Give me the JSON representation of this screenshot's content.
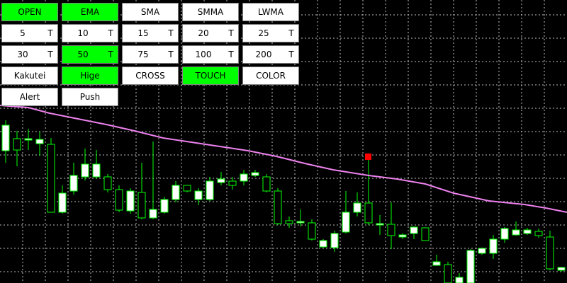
{
  "panel": {
    "row1": [
      {
        "label": "OPEN",
        "active": true
      },
      {
        "label": "EMA",
        "active": true
      },
      {
        "label": "SMA",
        "active": false
      },
      {
        "label": "SMMA",
        "active": false
      },
      {
        "label": "LWMA",
        "active": false
      }
    ],
    "periods": [
      {
        "value": "5",
        "t": "T",
        "active": false
      },
      {
        "value": "10",
        "t": "T",
        "active": false
      },
      {
        "value": "15",
        "t": "T",
        "active": false
      },
      {
        "value": "20",
        "t": "T",
        "active": false
      },
      {
        "value": "25",
        "t": "T",
        "active": false
      },
      {
        "value": "30",
        "t": "T",
        "active": false
      },
      {
        "value": "50",
        "t": "T",
        "active": true
      },
      {
        "value": "75",
        "t": "T",
        "active": false
      },
      {
        "value": "100",
        "t": "T",
        "active": false
      },
      {
        "value": "200",
        "t": "T",
        "active": false
      }
    ],
    "row4": [
      {
        "label": "Kakutei",
        "active": false
      },
      {
        "label": "Hige",
        "active": true
      },
      {
        "label": "CROSS",
        "active": false
      },
      {
        "label": "TOUCH",
        "active": true
      },
      {
        "label": "COLOR",
        "active": false
      }
    ],
    "row5": [
      {
        "label": "Alert",
        "active": false
      },
      {
        "label": "Push",
        "active": false
      }
    ]
  },
  "colors": {
    "background": "#000000",
    "grid": "#c0c0c0",
    "candle_bull": "#ffffff",
    "candle_bear": "#000000",
    "wick": "#00ff00",
    "ma_line": "#ee82ee",
    "signal_marker": "#ff0000",
    "button_active": "#00ff00",
    "button_inactive": "#ffffff"
  }
}
